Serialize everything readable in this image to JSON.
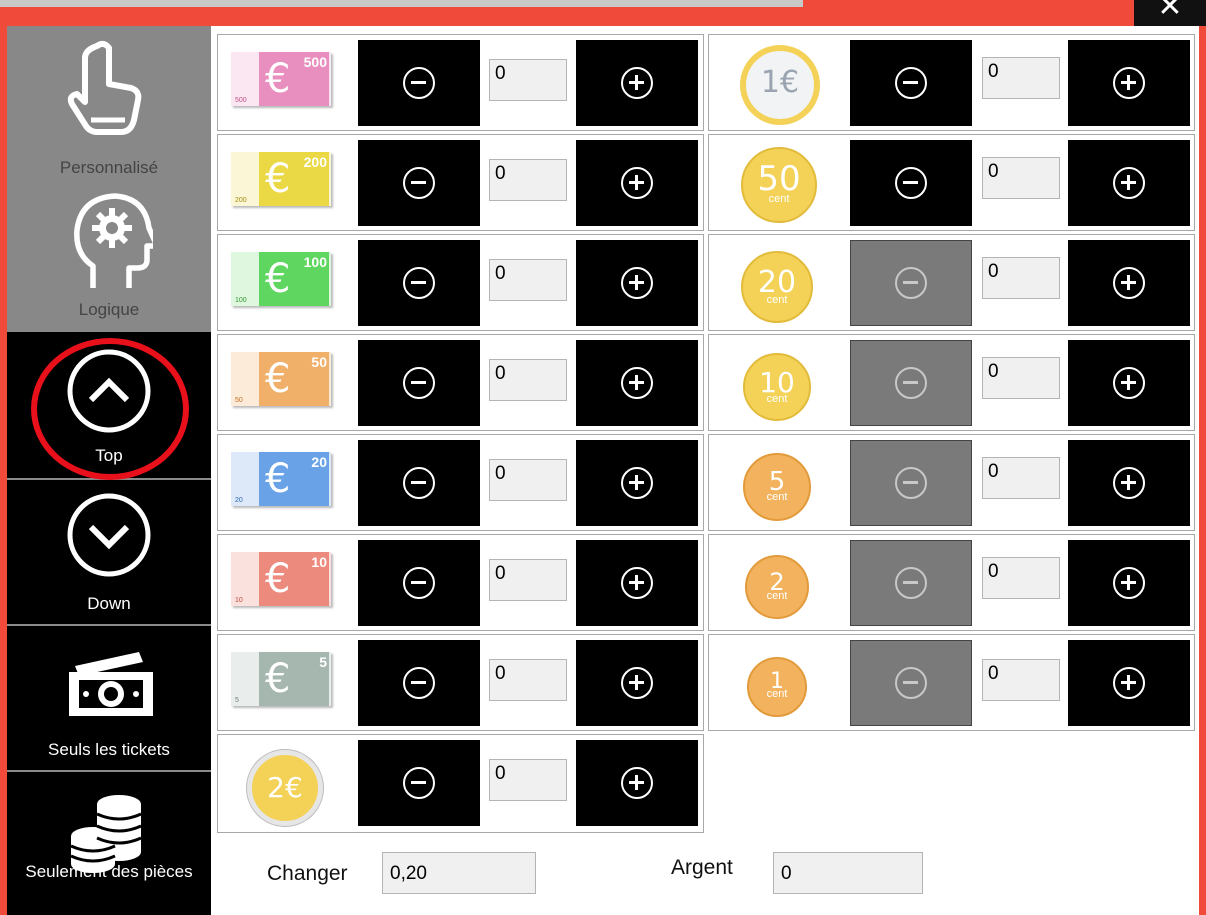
{
  "window": {
    "close_glyph": "✕"
  },
  "sidebar": {
    "items": [
      {
        "label": "Personnalisé",
        "icon": "hand-pointer-icon"
      },
      {
        "label": "Logique",
        "icon": "head-gear-icon"
      },
      {
        "label": "Top",
        "icon": "chevron-up-circle-icon"
      },
      {
        "label": "Down",
        "icon": "chevron-down-circle-icon"
      },
      {
        "label": "Seuls les tickets",
        "icon": "banknotes-icon"
      },
      {
        "label": "Seulement des pièces",
        "icon": "coins-stack-icon"
      }
    ]
  },
  "banknotes": [
    {
      "value": "500",
      "qty": "0",
      "color": "#e98fbf",
      "band": "#f3a6cf"
    },
    {
      "value": "200",
      "qty": "0",
      "color": "#ead845",
      "band": "#f2e46a"
    },
    {
      "value": "100",
      "qty": "0",
      "color": "#5fd65f",
      "band": "#86e886"
    },
    {
      "value": "50",
      "qty": "0",
      "color": "#f0b06a",
      "band": "#f6c58f"
    },
    {
      "value": "20",
      "qty": "0",
      "color": "#6aa2e8",
      "band": "#8db9f0"
    },
    {
      "value": "10",
      "qty": "0",
      "color": "#ec8a7e",
      "band": "#f2a79e"
    },
    {
      "value": "5",
      "qty": "0",
      "color": "#a6b7b0",
      "band": "#bfcac5"
    }
  ],
  "coins": [
    {
      "value": "1€",
      "cent": "",
      "qty": "0",
      "minus_enabled": true
    },
    {
      "value": "50",
      "cent": "cent",
      "qty": "0",
      "minus_enabled": true
    },
    {
      "value": "20",
      "cent": "cent",
      "qty": "0",
      "minus_enabled": false
    },
    {
      "value": "10",
      "cent": "cent",
      "qty": "0",
      "minus_enabled": false
    },
    {
      "value": "5",
      "cent": "cent",
      "qty": "0",
      "minus_enabled": false
    },
    {
      "value": "2",
      "cent": "cent",
      "qty": "0",
      "minus_enabled": false
    },
    {
      "value": "1",
      "cent": "cent",
      "qty": "0",
      "minus_enabled": false
    }
  ],
  "extra_coin": {
    "value": "2€",
    "qty": "0"
  },
  "footer": {
    "change_label": "Changer",
    "change_value": "0,20",
    "money_label": "Argent",
    "money_value": "0"
  },
  "colors": {
    "accent": "#f04a3a",
    "highlight_ring": "#e8101a",
    "gold_coin": "#f3d257",
    "copper_coin": "#f3b35e"
  }
}
